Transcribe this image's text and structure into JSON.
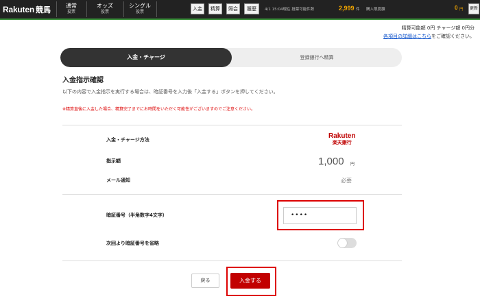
{
  "header": {
    "logo_main": "Rakuten",
    "logo_sub": "競馬",
    "nav": [
      {
        "label": "通常",
        "sub": "投票"
      },
      {
        "label": "オッズ",
        "sub": "投票"
      },
      {
        "label": "シングル",
        "sub": "投票"
      }
    ],
    "quick_buttons": [
      "入金",
      "精算",
      "照会",
      "履歴"
    ],
    "info_text": "4/1 15:04現在  投票可能件数",
    "points": "2,999",
    "points_unit": "件",
    "purchase_limit_label": "購入限度額",
    "balance": "0",
    "balance_unit": "円",
    "refresh_label": "更新"
  },
  "account_info": {
    "line1": "精算可能額 0円 チャージ額 0円分",
    "details_link": "各項目の詳細はこちら",
    "details_suffix": "をご確認ください。"
  },
  "tabs": [
    {
      "label": "入金・チャージ",
      "active": true
    },
    {
      "label": "登録銀行へ精算",
      "active": false
    }
  ],
  "page": {
    "title": "入金指示確認",
    "description": "以下の内容で入金指示を実行する場合は、暗証番号を入力後「入金する」ボタンを押してください。",
    "notice": "※精算直後に入金した場合、精算完了までにお時間をいただく可能性がございますのでご注意ください。"
  },
  "details": {
    "method_label": "入金・チャージ方法",
    "bank_logo_top": "Rakuten",
    "bank_logo_bottom": "楽天銀行",
    "amount_label": "指示額",
    "amount_value": "1,000",
    "amount_unit": "円",
    "mail_label": "メール通知",
    "mail_value": "必要"
  },
  "pin": {
    "label": "暗証番号（半角数字4文字）",
    "value": "••••"
  },
  "skip_pin": {
    "label": "次回より暗証番号を省略",
    "enabled": false
  },
  "buttons": {
    "back": "戻る",
    "submit": "入金する"
  },
  "colors": {
    "brand_red": "#c20000",
    "highlight_red": "#dd0000",
    "topbar": "#222222",
    "accent_orange": "#f0a500"
  }
}
